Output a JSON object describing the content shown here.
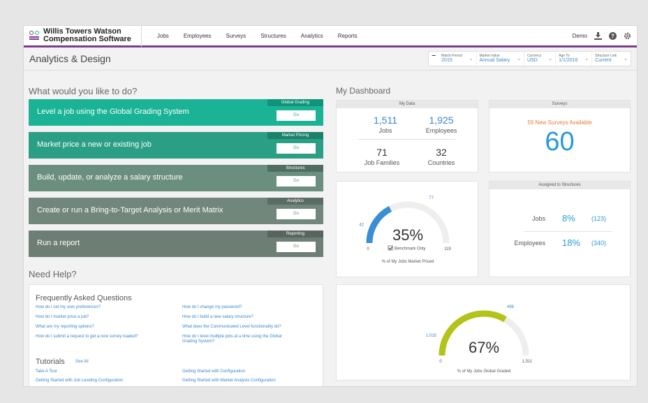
{
  "brand": {
    "name_line1": "Willis Towers Watson",
    "name_line2": "Compensation Software"
  },
  "nav": {
    "items": [
      "Jobs",
      "Employees",
      "Surveys",
      "Structures",
      "Analytics",
      "Reports"
    ],
    "user": "Demo"
  },
  "page": {
    "title": "Analytics & Design"
  },
  "filters": [
    {
      "label": "Match Period",
      "value": "2015"
    },
    {
      "label": "Market Value",
      "value": "Annual Salary"
    },
    {
      "label": "Currency",
      "value": "USD"
    },
    {
      "label": "Age To",
      "value": "1/1/2016"
    },
    {
      "label": "Structure Link",
      "value": "Current"
    }
  ],
  "todo": {
    "heading": "What would you like to do?",
    "actions": [
      {
        "text": "Level a job using the Global Grading System",
        "tag": "Global Grading",
        "go": "Go",
        "color": "#1ab396",
        "tagcolor": "#0e9479"
      },
      {
        "text": "Market price a new or existing job",
        "tag": "Market Pricing",
        "go": "Go",
        "color": "#2a9f86",
        "tagcolor": "#1b8168"
      },
      {
        "text": "Build, update, or analyze a salary structure",
        "tag": "Structures",
        "go": "Go",
        "color": "#6b8f7e",
        "tagcolor": "#4f6e61"
      },
      {
        "text": "Create or run a Bring-to-Target Analysis or Merit Matrix",
        "tag": "Analytics",
        "go": "Go",
        "color": "#72877c",
        "tagcolor": "#5a6c63"
      },
      {
        "text": "Run a report",
        "tag": "Reporting",
        "go": "Go",
        "color": "#6d7f75",
        "tagcolor": "#56665d"
      }
    ]
  },
  "help": {
    "heading": "Need Help?",
    "faq_title": "Frequently Asked Questions",
    "faq_left": [
      "How do I set my user preferences?",
      "How do I market price a job?",
      "What are my reporting options?",
      "How do I submit a request to get a new survey loaded?"
    ],
    "faq_right": [
      "How do I change my password?",
      "How do I build a new salary structure?",
      "What does the Communicated Level functionality do?",
      "How do I level multiple jobs at a time using the Global",
      "Grading System?"
    ],
    "tutorials_title": "Tutorials",
    "see_all": "See All",
    "tut_left": [
      "Take A Tour",
      "Getting Started with Job Leveling Configuration"
    ],
    "tut_right": [
      "Getting Started with Configuration",
      "Getting Started with Market Analysis Configuration"
    ]
  },
  "dashboard": {
    "heading": "My Dashboard",
    "mydata": {
      "title": "My Data",
      "jobs": "1,511",
      "jobs_lbl": "Jobs",
      "employees": "1,925",
      "employees_lbl": "Employees",
      "families": "71",
      "families_lbl": "Job Families",
      "countries": "32",
      "countries_lbl": "Countries"
    },
    "surveys": {
      "title": "Surveys",
      "note": "59 New Surveys Available",
      "count": "60"
    },
    "market": {
      "percent": "35%",
      "fraction": 0.35,
      "left": "42",
      "right": "77",
      "min": "0",
      "max": "119",
      "checkbox": "Benchmark Only",
      "caption": "% of My Jobs Market Priced"
    },
    "structures": {
      "title": "Assigned to Structures",
      "rows": [
        {
          "label": "Jobs",
          "pct": "8%",
          "count": "(123)"
        },
        {
          "label": "Employees",
          "pct": "18%",
          "count": "(340)"
        }
      ]
    },
    "graded": {
      "percent": "67%",
      "fraction": 0.67,
      "left": "1,015",
      "right": "496",
      "min": "0",
      "max": "1,511",
      "caption": "% of My Jobs Global Graded"
    }
  }
}
